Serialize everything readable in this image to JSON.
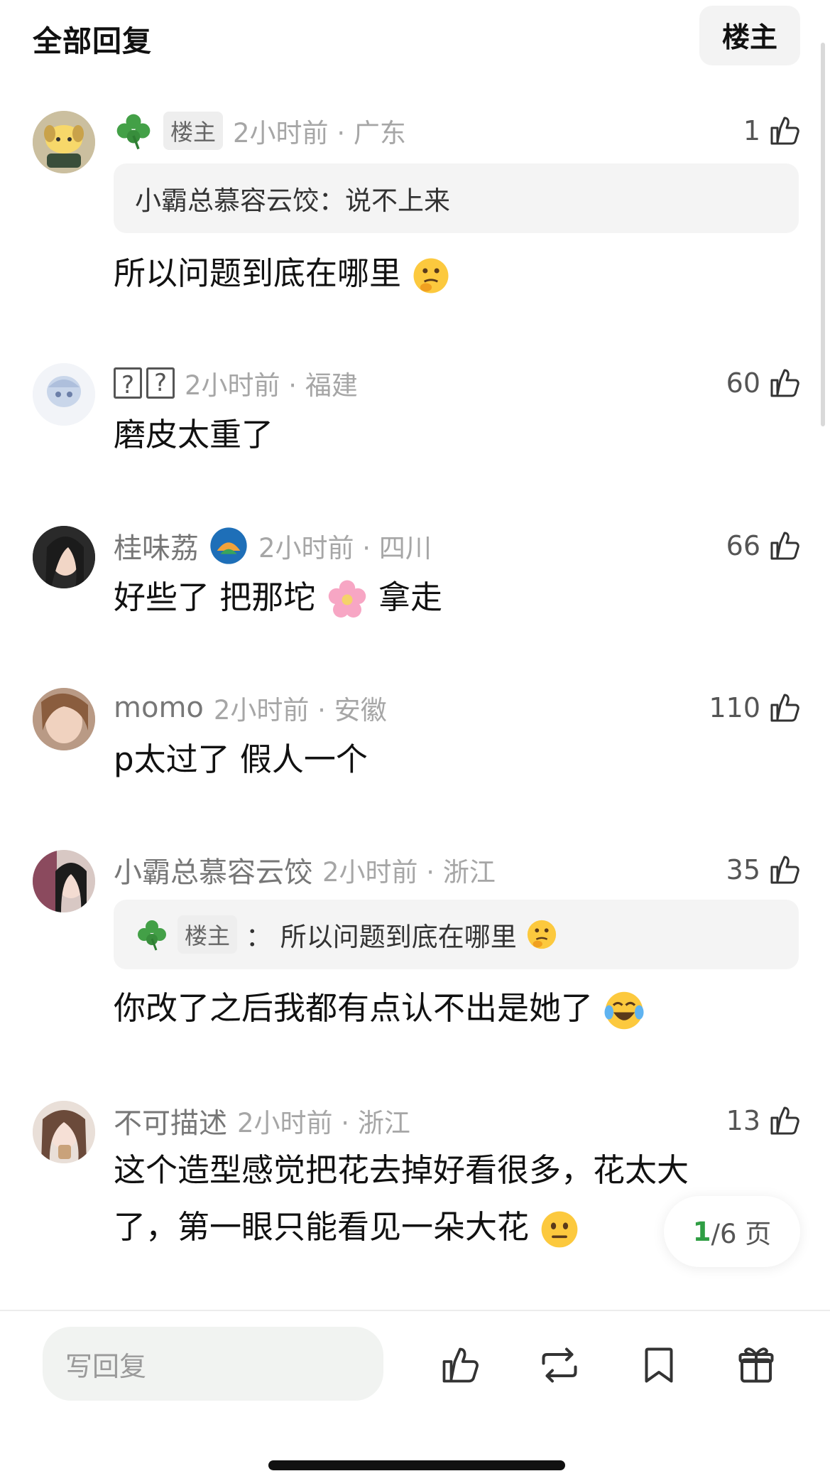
{
  "header": {
    "title": "全部回复",
    "op_filter_label": "楼主"
  },
  "comments": [
    {
      "time_location": "2小时前 · 广东",
      "op_badge": "楼主",
      "likes": "1",
      "quote": "小霸总慕容云饺：说不上来",
      "text": "所以问题到底在哪里"
    },
    {
      "username": "?? ",
      "time_location": "2小时前 · 福建",
      "likes": "60",
      "text": "磨皮太重了"
    },
    {
      "username": "桂味荔",
      "time_location": "2小时前 · 四川",
      "likes": "66",
      "text_a": "好些了 把那坨",
      "text_b": "拿走"
    },
    {
      "username": "momo",
      "time_location": "2小时前 · 安徽",
      "likes": "110",
      "text": "p太过了 假人一个"
    },
    {
      "username": "小霸总慕容云饺",
      "time_location": "2小时前 · 浙江",
      "likes": "35",
      "quote_badge": "楼主",
      "quote_text": "： 所以问题到底在哪里",
      "text": "你改了之后我都有点认不出是她了"
    },
    {
      "username": "不可描述",
      "time_location": "2小时前 · 浙江",
      "likes": "13",
      "text_line1": "这个造型感觉把花去掉好看很多，花太大",
      "text_line2": "了，第一眼只能看见一朵大花"
    }
  ],
  "pager": {
    "current": "1",
    "total_label": "/6 页"
  },
  "bottom_bar": {
    "reply_placeholder": "写回复"
  },
  "colors": {
    "accent_green": "#2f9e44",
    "clover_green": "#43a047"
  },
  "icons": [
    "clover-icon",
    "thumbs-up-icon",
    "thinking-face-emoji",
    "cherry-blossom-emoji",
    "tears-of-joy-emoji",
    "neutral-face-emoji",
    "repost-icon",
    "bookmark-icon",
    "gift-icon"
  ]
}
